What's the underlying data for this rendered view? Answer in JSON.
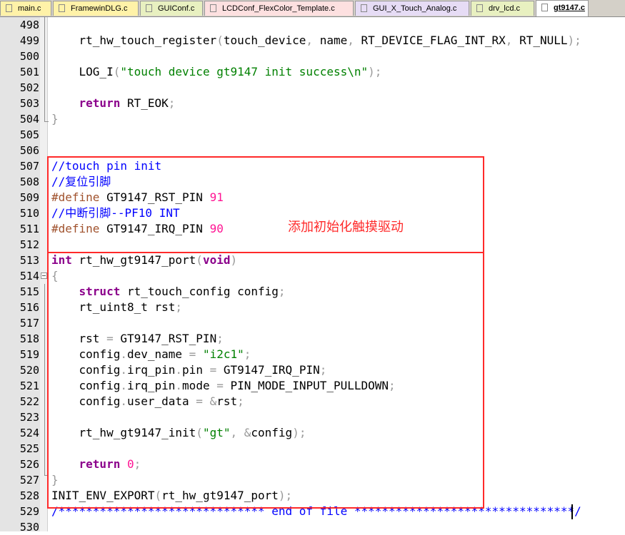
{
  "tabs": [
    {
      "label": "main.c",
      "active": false,
      "color": "#fff2a8"
    },
    {
      "label": "FramewinDLG.c",
      "active": false,
      "color": "#fff2a8"
    },
    {
      "label": "GUIConf.c",
      "active": false,
      "color": "#e8f0c0"
    },
    {
      "label": "LCDConf_FlexColor_Template.c",
      "active": false,
      "color": "#fde0e0"
    },
    {
      "label": "GUI_X_Touch_Analog.c",
      "active": false,
      "color": "#e6dcf5"
    },
    {
      "label": "drv_lcd.c",
      "active": false,
      "color": "#e8f0c0"
    },
    {
      "label": "gt9147.c",
      "active": true,
      "color": "#ffffff"
    }
  ],
  "annotation": "添加初始化触摸驱动",
  "lines": [
    {
      "n": "498",
      "t": []
    },
    {
      "n": "499",
      "t": [
        [
          "",
          "    rt_hw_touch_register"
        ],
        [
          "op",
          "("
        ],
        [
          "",
          "touch_device"
        ],
        [
          "op",
          ","
        ],
        [
          "",
          " name"
        ],
        [
          "op",
          ","
        ],
        [
          "",
          " RT_DEVICE_FLAG_INT_RX"
        ],
        [
          "op",
          ","
        ],
        [
          "",
          " RT_NULL"
        ],
        [
          "op",
          ");"
        ]
      ]
    },
    {
      "n": "500",
      "t": []
    },
    {
      "n": "501",
      "t": [
        [
          "",
          "    LOG_I"
        ],
        [
          "op",
          "("
        ],
        [
          "str",
          "\"touch device gt9147 init success\\n\""
        ],
        [
          "op",
          ");"
        ]
      ]
    },
    {
      "n": "502",
      "t": []
    },
    {
      "n": "503",
      "t": [
        [
          "kw",
          "    return"
        ],
        [
          "",
          " RT_EOK"
        ],
        [
          "op",
          ";"
        ]
      ]
    },
    {
      "n": "504",
      "t": [
        [
          "op",
          "}"
        ]
      ]
    },
    {
      "n": "505",
      "t": []
    },
    {
      "n": "506",
      "t": []
    },
    {
      "n": "507",
      "t": [
        [
          "cm",
          "//touch pin init"
        ]
      ]
    },
    {
      "n": "508",
      "t": [
        [
          "cm",
          "//复位引脚"
        ]
      ]
    },
    {
      "n": "509",
      "t": [
        [
          "pp",
          "#define"
        ],
        [
          "",
          " GT9147_RST_PIN "
        ],
        [
          "num",
          "91"
        ]
      ]
    },
    {
      "n": "510",
      "t": [
        [
          "cm",
          "//中断引脚--PF10 INT"
        ]
      ]
    },
    {
      "n": "511",
      "t": [
        [
          "pp",
          "#define"
        ],
        [
          "",
          " GT9147_IRQ_PIN "
        ],
        [
          "num",
          "90"
        ]
      ]
    },
    {
      "n": "512",
      "t": []
    },
    {
      "n": "513",
      "t": [
        [
          "ty",
          "int"
        ],
        [
          "",
          " rt_hw_gt9147_port"
        ],
        [
          "op",
          "("
        ],
        [
          "ty",
          "void"
        ],
        [
          "op",
          ")"
        ]
      ]
    },
    {
      "n": "514",
      "t": [
        [
          "op",
          "{"
        ]
      ]
    },
    {
      "n": "515",
      "t": [
        [
          "kw",
          "    struct"
        ],
        [
          "",
          " rt_touch_config config"
        ],
        [
          "op",
          ";"
        ]
      ]
    },
    {
      "n": "516",
      "t": [
        [
          "",
          "    rt_uint8_t rst"
        ],
        [
          "op",
          ";"
        ]
      ]
    },
    {
      "n": "517",
      "t": []
    },
    {
      "n": "518",
      "t": [
        [
          "",
          "    rst "
        ],
        [
          "op",
          "="
        ],
        [
          "",
          " GT9147_RST_PIN"
        ],
        [
          "op",
          ";"
        ]
      ]
    },
    {
      "n": "519",
      "t": [
        [
          "",
          "    config"
        ],
        [
          "op",
          "."
        ],
        [
          "",
          "dev_name "
        ],
        [
          "op",
          "="
        ],
        [
          "",
          " "
        ],
        [
          "str",
          "\"i2c1\""
        ],
        [
          "op",
          ";"
        ]
      ]
    },
    {
      "n": "520",
      "t": [
        [
          "",
          "    config"
        ],
        [
          "op",
          "."
        ],
        [
          "",
          "irq_pin"
        ],
        [
          "op",
          "."
        ],
        [
          "",
          "pin "
        ],
        [
          "op",
          "="
        ],
        [
          "",
          " GT9147_IRQ_PIN"
        ],
        [
          "op",
          ";"
        ]
      ]
    },
    {
      "n": "521",
      "t": [
        [
          "",
          "    config"
        ],
        [
          "op",
          "."
        ],
        [
          "",
          "irq_pin"
        ],
        [
          "op",
          "."
        ],
        [
          "",
          "mode "
        ],
        [
          "op",
          "="
        ],
        [
          "",
          " PIN_MODE_INPUT_PULLDOWN"
        ],
        [
          "op",
          ";"
        ]
      ]
    },
    {
      "n": "522",
      "t": [
        [
          "",
          "    config"
        ],
        [
          "op",
          "."
        ],
        [
          "",
          "user_data "
        ],
        [
          "op",
          "="
        ],
        [
          "",
          " "
        ],
        [
          "op",
          "&"
        ],
        [
          "",
          "rst"
        ],
        [
          "op",
          ";"
        ]
      ]
    },
    {
      "n": "523",
      "t": []
    },
    {
      "n": "524",
      "t": [
        [
          "",
          "    rt_hw_gt9147_init"
        ],
        [
          "op",
          "("
        ],
        [
          "str",
          "\"gt\""
        ],
        [
          "op",
          ","
        ],
        [
          "",
          " "
        ],
        [
          "op",
          "&"
        ],
        [
          "",
          "config"
        ],
        [
          "op",
          ");"
        ]
      ]
    },
    {
      "n": "525",
      "t": []
    },
    {
      "n": "526",
      "t": [
        [
          "kw",
          "    return"
        ],
        [
          "",
          " "
        ],
        [
          "num",
          "0"
        ],
        [
          "op",
          ";"
        ]
      ]
    },
    {
      "n": "527",
      "t": [
        [
          "op",
          "}"
        ]
      ]
    },
    {
      "n": "528",
      "t": [
        [
          "",
          "INIT_ENV_EXPORT"
        ],
        [
          "op",
          "("
        ],
        [
          "",
          "rt_hw_gt9147_port"
        ],
        [
          "op",
          ");"
        ]
      ]
    },
    {
      "n": "529",
      "t": [
        [
          "cm",
          "/****************************** end of file ********************************/"
        ]
      ]
    },
    {
      "n": "530",
      "t": []
    }
  ]
}
